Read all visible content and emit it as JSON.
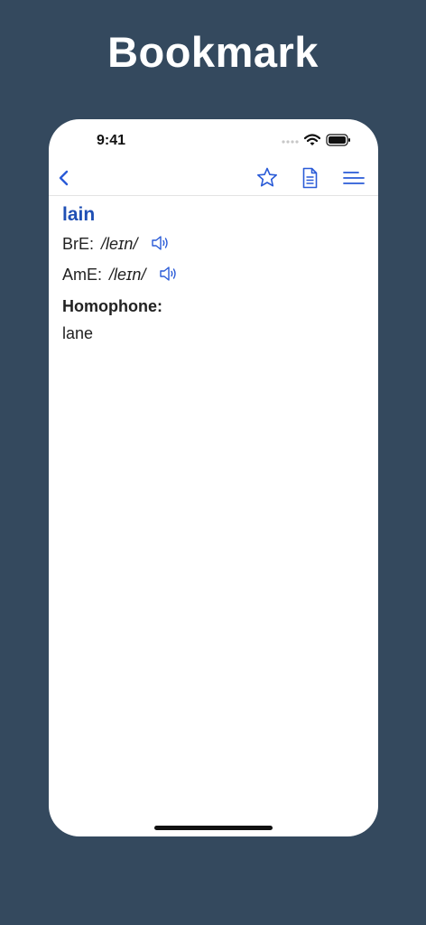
{
  "headline": "Bookmark",
  "status_bar": {
    "time": "9:41"
  },
  "nav": {
    "back_icon": "chevron-left-icon",
    "bookmark_icon": "star-icon",
    "document_icon": "document-icon",
    "menu_icon": "menu-icon"
  },
  "entry": {
    "word": "lain",
    "pronunciations": [
      {
        "label": "BrE:",
        "ipa": "/leɪn/"
      },
      {
        "label": "AmE:",
        "ipa": "/leɪn/"
      }
    ],
    "homophone_label": "Homophone:",
    "homophone": "lane"
  },
  "colors": {
    "background": "#34495e",
    "accent": "#1f4fb4",
    "icon_blue": "#2a5bd7"
  }
}
